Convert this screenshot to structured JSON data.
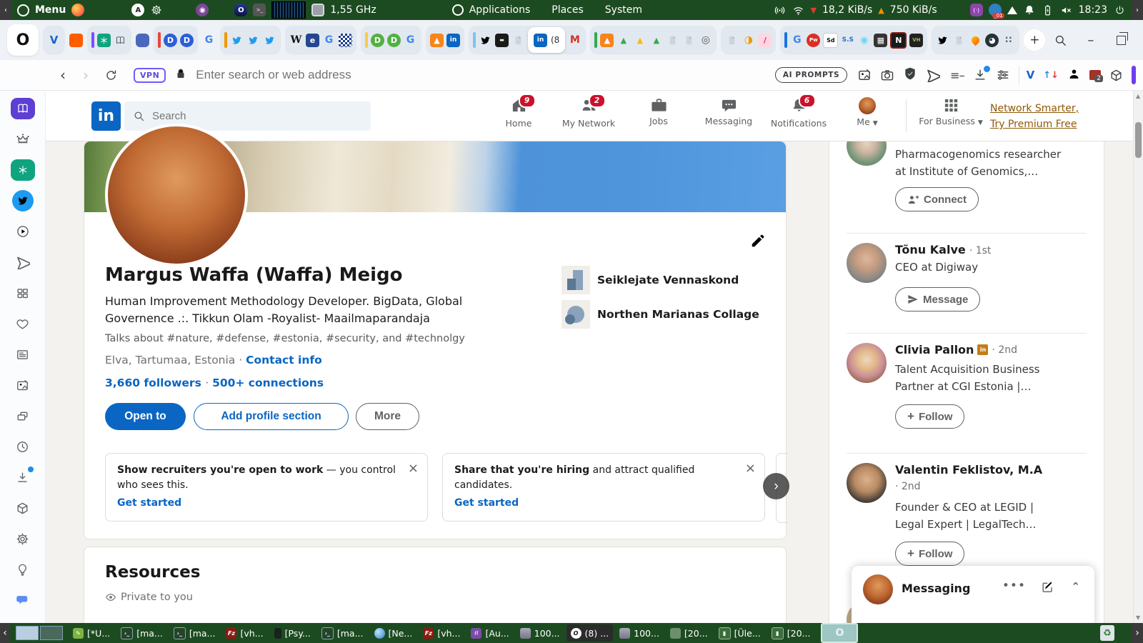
{
  "colors": {
    "accent_blue": "#0a66c2",
    "badge_red": "#cb112d",
    "premium_gold": "#915907",
    "panel_green": "#1d4b21",
    "vpn_purple": "#6e5bff"
  },
  "system_bar": {
    "menu": "Menu",
    "cpu": "1,55 GHz",
    "applications": "Applications",
    "places": "Places",
    "system": "System",
    "net_down": "18,2 KiB/s",
    "net_up": "750 KiB/s",
    "tray_badge": "_01",
    "time": "18:23"
  },
  "browser": {
    "vpn": "VPN",
    "address_placeholder": "Enter search or web address",
    "ai_prompts": "AI PROMPTS",
    "ext_badge": "2",
    "fav": {
      "v": "V",
      "err": "err",
      "d": "D",
      "g": "G",
      "w": "W",
      "e": "e",
      "in": "in",
      "m": "M",
      "tri": "▲",
      "rings": "◎",
      "half": "◑",
      "slash": "/",
      "pw": "Pw",
      "sd": "Sd",
      "ss": "S.S",
      "atom": "◉",
      "grid": "▦",
      "n": "N",
      "vh": "VH",
      "gauge": "◕",
      "dots": "∷",
      "plus": "+",
      "o": "O",
      "fz": "Fz",
      "active_title": "(8"
    }
  },
  "linkedin": {
    "nav": {
      "logo": "in",
      "search_placeholder": "Search",
      "home": "Home",
      "home_badge": "9",
      "network": "My Network",
      "network_badge": "2",
      "jobs": "Jobs",
      "messaging": "Messaging",
      "notifications": "Notifications",
      "notifications_badge": "6",
      "me": "Me",
      "for_business": "For Business",
      "premium1": "Network Smarter,",
      "premium2": "Try Premium Free"
    },
    "profile": {
      "name": "Margus Waffa (Waffa) Meigo",
      "headline": "Human Improvement Methodology Developer. BigData, Global Governence .:. Tikkun Olam -Royalist- Maailmaparandaja",
      "talks": "Talks about #nature, #defense, #estonia, #security, and #technolgy",
      "location": "Elva, Tartumaa, Estonia",
      "sep": "·",
      "contact_info": "Contact info",
      "followers": "3,660 followers",
      "connections": "500+ connections",
      "org1": "Seiklejate Vennaskond",
      "org2": "Northen Marianas Collage",
      "open_to": "Open to",
      "add_section": "Add profile section",
      "more": "More"
    },
    "promos": {
      "c1_bold": "Show recruiters you're open to work",
      "c1_rest": " — you control who sees this.",
      "c1_link": "Get started",
      "c2_bold": "Share that you're hiring",
      "c2_rest": " and attract qualified candidates.",
      "c2_link": "Get started"
    },
    "resources": {
      "title": "Resources",
      "privacy": "Private to you"
    },
    "rail": {
      "p1_headline1": "Pharmacogenomics researcher",
      "p1_headline2": "at Institute of Genomics,…",
      "p1_button": "Connect",
      "p2_name": "Tõnu Kalve",
      "p2_degree": "· 1st",
      "p2_headline": "CEO at Digiway",
      "p2_button": "Message",
      "p3_name": "Clivia Pallon",
      "p3_degree": "· 2nd",
      "p3_headline1": "Talent Acquisition Business",
      "p3_headline2": "Partner at CGI Estonia |…",
      "p3_button": "Follow",
      "p4_name": "Valentin Feklistov, M.A",
      "p4_degree": "· 2nd",
      "p4_headline1": "Founder & CEO at LEGID |",
      "p4_headline2": "Legal Expert | LegalTech…",
      "p4_button": "Follow"
    },
    "messaging_panel": "Messaging"
  },
  "taskbar": {
    "w0": "[*U...",
    "w1": "[ma...",
    "w2": "[ma...",
    "w3": "[vh...",
    "w4": "[Psy...",
    "w5": "[ma...",
    "w6": "[Ne...",
    "w7": "[vh...",
    "w8": "[Au...",
    "w9": "100...",
    "w10": "(8) ...",
    "w11": "100...",
    "w12": "[20...",
    "w13": "[Üle...",
    "w14": "[20..."
  }
}
